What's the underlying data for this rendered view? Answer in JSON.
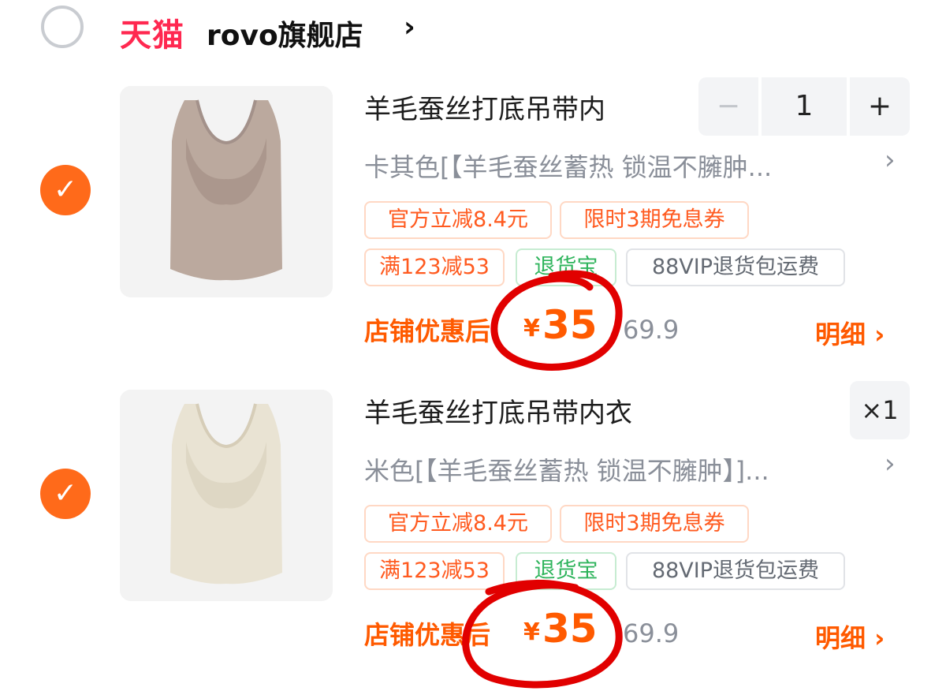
{
  "store": {
    "brand": "天猫",
    "name": "rovo旗舰店",
    "chevron": "›"
  },
  "items": [
    {
      "title": "羊毛蚕丝打底吊带内",
      "sku": "卡其色[【羊毛蚕丝蓄热 锁温不臃肿...",
      "quantity": "1",
      "tags_row1": [
        "官方立减8.4元",
        "限时3期免息券"
      ],
      "tags_row2": [
        "满123减53",
        "退货宝",
        "88VIP退货包运费"
      ],
      "price_label": "店铺优惠后",
      "currency": "¥",
      "price": "35",
      "original_price": "69.9",
      "detail_label": "明细 ›",
      "color": "#bfb1a7"
    },
    {
      "title": "羊毛蚕丝打底吊带内衣",
      "sku": "米色[【羊毛蚕丝蓄热 锁温不臃肿】]...",
      "quantity_badge": "×1",
      "tags_row1": [
        "官方立减8.4元",
        "限时3期免息券"
      ],
      "tags_row2": [
        "满123减53",
        "退货宝",
        "88VIP退货包运费"
      ],
      "price_label": "店铺优惠后",
      "currency": "¥",
      "price": "35",
      "original_price": "69.9",
      "detail_label": "明细 ›",
      "color": "#ebe6d8"
    }
  ],
  "controls": {
    "minus": "−",
    "plus": "+",
    "check": "✓",
    "sku_chevron": "›"
  },
  "colors": {
    "accent": "#ff5a00",
    "check": "#ff6a1a",
    "brand": "#ff2850",
    "annotation": "#e10000"
  }
}
